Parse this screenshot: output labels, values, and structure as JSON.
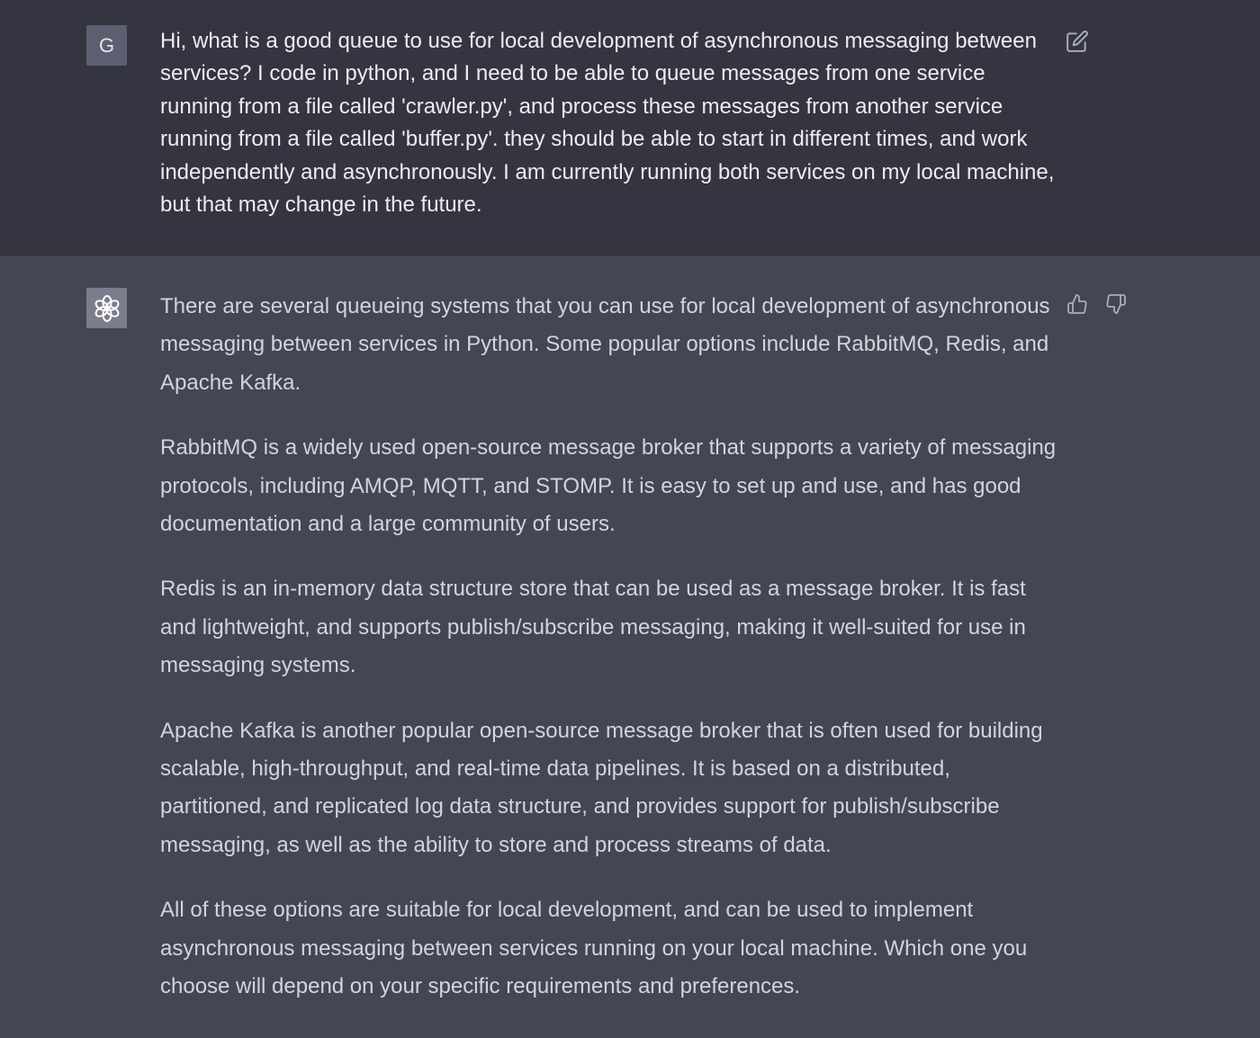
{
  "user_message": {
    "avatar_letter": "G",
    "text": "Hi, what is a good queue to use for local development of asynchronous messaging between services? I code in python, and I need to be able to queue messages from one service running from a file called 'crawler.py', and process these messages from another service running from a file called 'buffer.py'. they should be able to start in different times, and work independently and asynchronously. I am currently running both services on my local machine, but that may change in the future."
  },
  "assistant_message": {
    "paragraphs": [
      "There are several queueing systems that you can use for local development of asynchronous messaging between services in Python. Some popular options include RabbitMQ, Redis, and Apache Kafka.",
      "RabbitMQ is a widely used open-source message broker that supports a variety of messaging protocols, including AMQP, MQTT, and STOMP. It is easy to set up and use, and has good documentation and a large community of users.",
      "Redis is an in-memory data structure store that can be used as a message broker. It is fast and lightweight, and supports publish/subscribe messaging, making it well-suited for use in messaging systems.",
      "Apache Kafka is another popular open-source message broker that is often used for building scalable, high-throughput, and real-time data pipelines. It is based on a distributed, partitioned, and replicated log data structure, and provides support for publish/subscribe messaging, as well as the ability to store and process streams of data.",
      "All of these options are suitable for local development, and can be used to implement asynchronous messaging between services running on your local machine. Which one you choose will depend on your specific requirements and preferences."
    ]
  },
  "icons": {
    "edit": "edit-icon",
    "thumbs_up": "thumbs-up-icon",
    "thumbs_down": "thumbs-down-icon",
    "bot_logo": "openai-logo-icon"
  },
  "colors": {
    "user_bg": "#343541",
    "assistant_bg": "#444654",
    "text": "#d1d5db"
  }
}
